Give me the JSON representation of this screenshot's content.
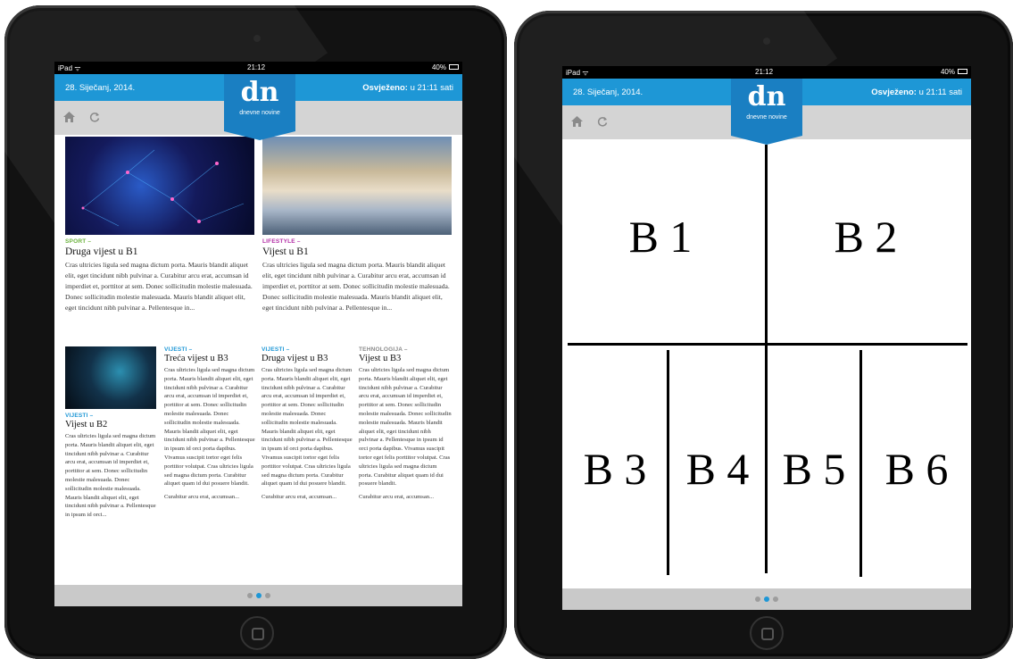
{
  "left_ipad": {
    "status": {
      "carrier": "iPad ᯤ",
      "time": "21:12",
      "battery": "40%"
    },
    "header": {
      "date": "28. Siječanj, 2014.",
      "refreshed_label": "Osvježeno:",
      "refreshed_value": "u 21:11 sati"
    },
    "logo": {
      "mark": "dn",
      "caption": "dnevne novine"
    },
    "articles_top": [
      {
        "category": "SPORT –",
        "category_color": "#6cb33e",
        "title": "Druga vijest u B1",
        "body": "Cras ultricies ligula sed magna dictum porta. Mauris blandit aliquet elit, eget tincidunt nibh pulvinar a. Curabitur arcu erat, accumsan id imperdiet et, porttitor at sem. Donec sollicitudin molestie malesuada. Donec sollicitudin molestie malesuada. Mauris blandit aliquet elit, eget tincidunt nibh pulvinar a. Pellentesque in..."
      },
      {
        "category": "LIFESTYLE –",
        "category_color": "#b32fa6",
        "title": "Vijest u B1",
        "body": "Cras ultricies ligula sed magna dictum porta. Mauris blandit aliquet elit, eget tincidunt nibh pulvinar a. Curabitur arcu erat, accumsan id imperdiet et, porttitor at sem. Donec sollicitudin molestie malesuada. Donec sollicitudin molestie malesuada. Mauris blandit aliquet elit, eget tincidunt nibh pulvinar a. Pellentesque in..."
      }
    ],
    "articles_bottom": [
      {
        "category": "VIJESTI –",
        "category_color": "#1e97d6",
        "title": "Vijest u B2",
        "body": "Cras ultricies ligula sed magna dictum porta. Mauris blandit aliquet elit, eget tincidunt nibh pulvinar a. Curabitur arcu erat, accumsan id imperdiet et, porttitor at sem. Donec sollicitudin molestie malesuada. Donec sollicitudin molestie malesuada. Mauris blandit aliquet elit, eget tincidunt nibh pulvinar a. Pellentesque in ipsum id orci...",
        "more": ""
      },
      {
        "category": "VIJESTI –",
        "category_color": "#1e97d6",
        "title": "Treća vijest u B3",
        "body": "Cras ultricies ligula sed magna dictum porta. Mauris blandit aliquet elit, eget tincidunt nibh pulvinar a. Curabitur arcu erat, accumsan id imperdiet et, porttitor at sem. Donec sollicitudin molestie malesuada. Donec sollicitudin molestie malesuada. Mauris blandit aliquet elit, eget tincidunt nibh pulvinar a. Pellentesque in ipsum id orci porta dapibus. Vivamus suscipit tortor eget felis porttitor volutpat. Cras ultricies ligula sed magna dictum porta. Curabitur aliquet quam id dui posuere blandit.",
        "more": "Curabitur arcu erat, accumsan..."
      },
      {
        "category": "VIJESTI –",
        "category_color": "#1e97d6",
        "title": "Druga vijest u B3",
        "body": "Cras ultricies ligula sed magna dictum porta. Mauris blandit aliquet elit, eget tincidunt nibh pulvinar a. Curabitur arcu erat, accumsan id imperdiet et, porttitor at sem. Donec sollicitudin molestie malesuada. Donec sollicitudin molestie malesuada. Mauris blandit aliquet elit, eget tincidunt nibh pulvinar a. Pellentesque in ipsum id orci porta dapibus. Vivamus suscipit tortor eget felis porttitor volutpat. Cras ultricies ligula sed magna dictum porta. Curabitur aliquet quam id dui posuere blandit.",
        "more": "Curabitur arcu erat, accumsan..."
      },
      {
        "category": "TEHNOLOGIJA –",
        "category_color": "#8a8a8a",
        "title": "Vijest u B3",
        "body": "Cras ultricies ligula sed magna dictum porta. Mauris blandit aliquet elit, eget tincidunt nibh pulvinar a. Curabitur arcu erat, accumsan id imperdiet et, porttitor at sem. Donec sollicitudin molestie malesuada. Donec sollicitudin molestie malesuada. Mauris blandit aliquet elit, eget tincidunt nibh pulvinar a. Pellentesque in ipsum id orci porta dapibus. Vivamus suscipit tortor eget felis porttitor volutpat. Cras ultricies ligula sed magna dictum porta. Curabitur aliquet quam id dui posuere blandit.",
        "more": "Curabitur arcu erat, accumsan..."
      }
    ],
    "page_dots": {
      "count": 3,
      "active": 1
    }
  },
  "right_ipad": {
    "status": {
      "carrier": "iPad ᯤ",
      "time": "21:12",
      "battery": "40%"
    },
    "header": {
      "date": "28. Siječanj, 2014.",
      "refreshed_label": "Osvježeno:",
      "refreshed_value": "u 21:11 sati"
    },
    "logo": {
      "mark": "dn",
      "caption": "dnevne novine"
    },
    "zones": [
      "B 1",
      "B 2",
      "B 3",
      "B 4",
      "B 5",
      "B 6"
    ],
    "page_dots": {
      "count": 3,
      "active": 1
    }
  },
  "colors": {
    "header_blue": "#1e97d6",
    "toolbar_grey": "#d4d4d4",
    "footer_grey": "#c9c9c9",
    "device_black": "#121212"
  },
  "icons": {
    "home": "home-icon",
    "refresh": "refresh-icon",
    "wifi": "wifi-icon",
    "battery": "battery-icon"
  }
}
